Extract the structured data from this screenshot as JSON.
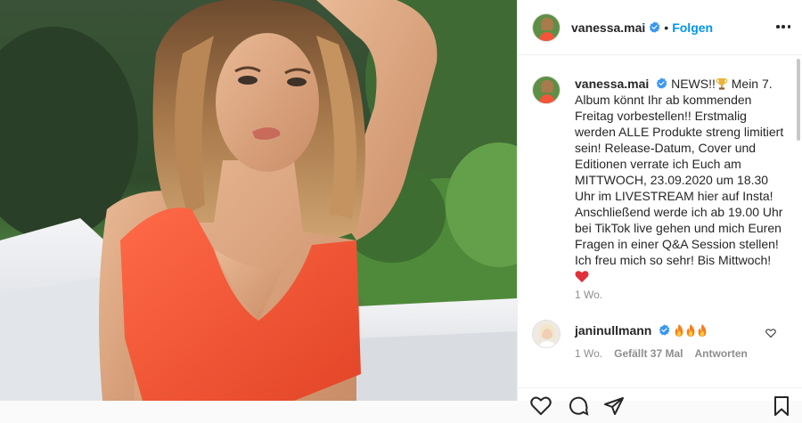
{
  "post": {
    "author": {
      "username": "vanessa.mai",
      "verified": true,
      "follow_label": "Folgen",
      "separator": "•"
    },
    "caption": {
      "username": "vanessa.mai",
      "lead": "NEWS!!",
      "text": "Mein 7. Album könnt Ihr ab kommenden Freitag vorbestellen!! Erstmalig werden ALLE Produkte streng limitiert sein! Release-Datum, Cover und Editionen verrate ich Euch am MITTWOCH, 23.09.2020 um 18.30 Uhr im LIVESTREAM hier auf Insta! Anschließend werde ich ab 19.00 Uhr bei TikTok live gehen und mich Euren Fragen in einer Q&A Session stellen! Ich freu mich so sehr! Bis Mittwoch!",
      "time": "1 Wo."
    },
    "comments": [
      {
        "username": "janinullmann",
        "verified": true,
        "time": "1 Wo.",
        "likes": "Gefällt 37 Mal",
        "reply_label": "Antworten"
      }
    ]
  },
  "icons": {
    "verified": "verified-badge-icon",
    "trophy": "trophy-emoji",
    "heart": "red-heart-emoji",
    "fire": "fire-emoji",
    "more": "more-options-icon",
    "like": "heart-outline-icon",
    "comment": "comment-icon",
    "share": "share-icon",
    "save": "bookmark-icon"
  },
  "colors": {
    "accent": "#0095f6",
    "text": "#262626",
    "muted": "#8e8e8e",
    "swimsuit": "#f2553a",
    "verified": "#3897f0",
    "heart": "#ed4956"
  }
}
